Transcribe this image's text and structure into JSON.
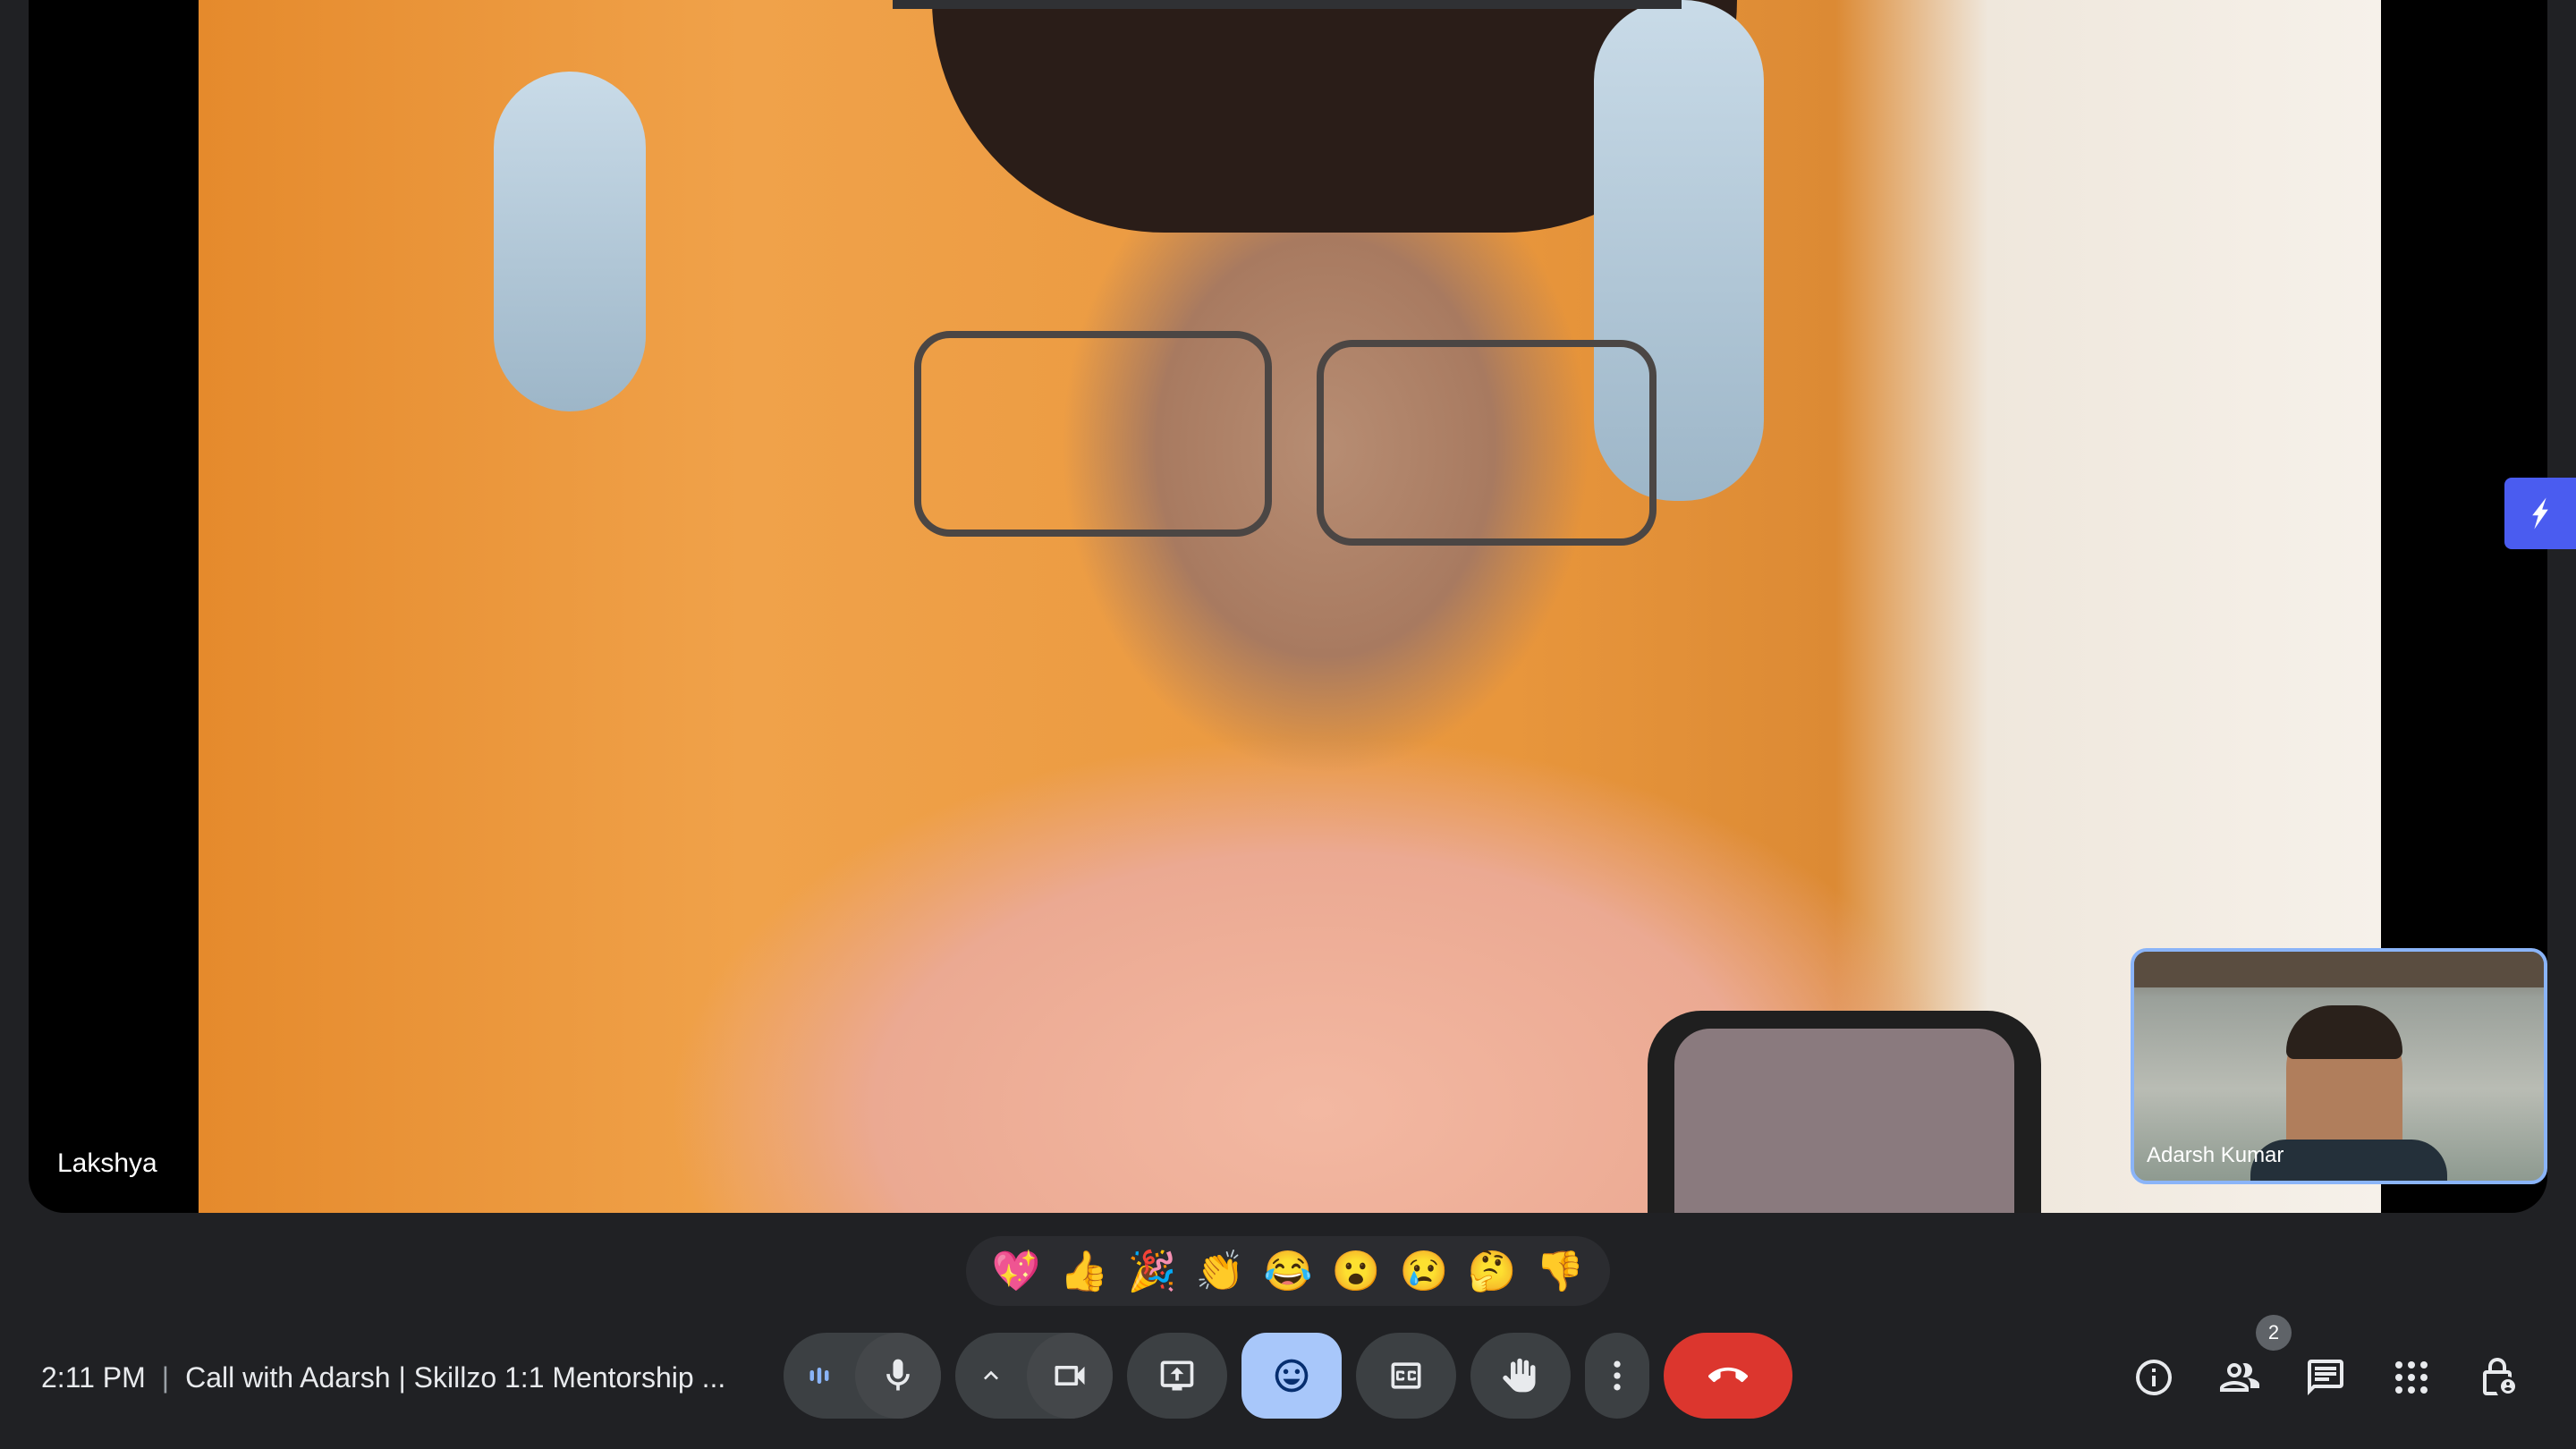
{
  "main_participant": {
    "name": "Lakshya"
  },
  "self_view": {
    "name": "Adarsh Kumar"
  },
  "reactions": [
    "💖",
    "👍",
    "🎉",
    "👏",
    "😂",
    "😮",
    "😢",
    "🤔",
    "👎"
  ],
  "meeting": {
    "time": "2:11 PM",
    "separator": "|",
    "title": "Call with Adarsh | Skillzo 1:1 Mentorship ..."
  },
  "people_count": "2",
  "colors": {
    "background": "#202124",
    "control": "#3c4043",
    "active_control": "#a8c7fa",
    "end_call": "#dc362e",
    "self_tile_border": "#8ab4f8",
    "side_widget": "#4a5cf0"
  },
  "icons": {
    "audio_level": "audio-level-icon",
    "mic": "microphone-icon",
    "chevron_up": "chevron-up-icon",
    "camera": "video-camera-icon",
    "present": "present-screen-icon",
    "emoji": "emoji-icon",
    "captions": "closed-captions-icon",
    "raise_hand": "raise-hand-icon",
    "more": "more-options-icon",
    "end_call": "end-call-icon",
    "info": "info-icon",
    "people": "people-icon",
    "chat": "chat-icon",
    "activities": "activities-grid-icon",
    "host_controls": "host-controls-lock-icon"
  }
}
